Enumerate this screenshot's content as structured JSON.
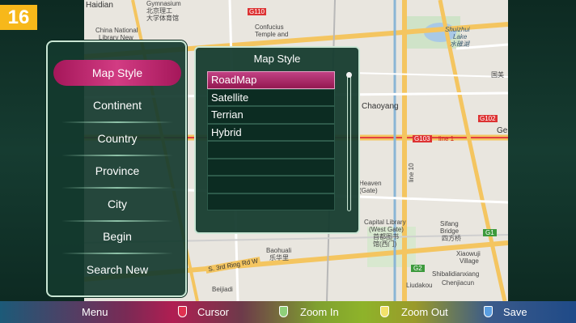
{
  "badge": "16",
  "colors": {
    "shield_red": "#e03050",
    "shield_green": "#8fd07a",
    "shield_yellow": "#f2e26a",
    "shield_blue": "#5a9ee0"
  },
  "menu": {
    "items": [
      {
        "label": "Map Style"
      },
      {
        "label": "Continent"
      },
      {
        "label": "Country"
      },
      {
        "label": "Province"
      },
      {
        "label": "City"
      },
      {
        "label": "Begin"
      },
      {
        "label": "Search New"
      }
    ]
  },
  "style_panel": {
    "title": "Map Style",
    "options": [
      "RoadMap",
      "Satellite",
      "Terrian",
      "Hybrid",
      "",
      "",
      "",
      ""
    ],
    "selected": "RoadMap"
  },
  "bottom_bar": {
    "menu_label": "Menu",
    "cursor_label": "Cursor",
    "zoom_in_label": "Zoom In",
    "zoom_out_label": "Zoom Out",
    "save_label": "Save"
  },
  "map_labels": {
    "l1": "Haidian",
    "l2": "Gymnasium",
    "l3": "北京理工",
    "l4": "大学体育馆",
    "l5": "China National",
    "l6": "Library New",
    "l7": "Confucius",
    "l8": "Temple and",
    "l9": "Shuizhui",
    "l10": "Lake",
    "l11": "水碓湖",
    "l12": "Chaoyang",
    "l13": "G102",
    "l14": "G103",
    "l15": "line 1",
    "l16": "G110",
    "l17": "Heaven",
    "l18": "(Gate)",
    "l19": "Capital Library",
    "l20": "(West Gate)",
    "l21": "首都图书",
    "l22": "馆(西门)",
    "l23": "Sifang",
    "l24": "Bridge",
    "l25": "四方桥",
    "l26": "Baohuali",
    "l27": "S. 3rd Ring Rd W",
    "l28": "Xiaowuji",
    "l29": "Village",
    "l30": "Shibalidianxiang",
    "l31": "Liudakou",
    "l32": "Chenjiacun",
    "l33": "Beijiadi",
    "l34": "line 10",
    "l35": "G1",
    "l36": "G2",
    "l37": "国美",
    "l38": "Ge",
    "l39": "乐华里"
  }
}
